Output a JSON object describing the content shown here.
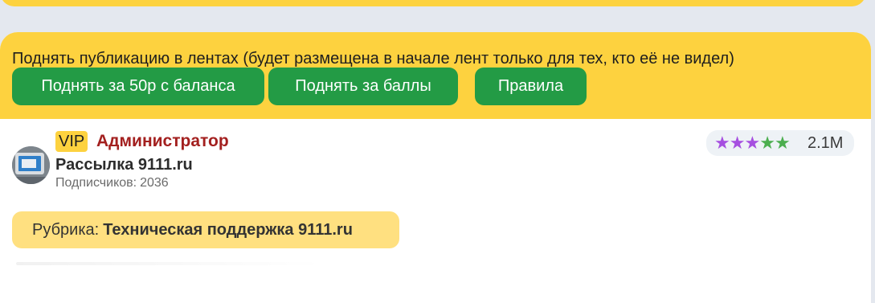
{
  "promo": {
    "text": "Поднять публикацию в лентах (будет размещена в начале лент только для тех, кто её не видел)",
    "buttons": {
      "raise_balance": "Поднять за 50р с баланса",
      "raise_points": "Поднять за баллы",
      "rules": "Правила"
    }
  },
  "author": {
    "badge": "VIP",
    "role": "Администратор",
    "channel_name": "Рассылка 9111.ru",
    "subscribers_label": "Подписчиков:",
    "subscribers_count": "2036"
  },
  "rating": {
    "stars": [
      {
        "symbol": "★",
        "color": "#a64fe0"
      },
      {
        "symbol": "★",
        "color": "#a64fe0"
      },
      {
        "symbol": "★",
        "color": "#a64fe0"
      },
      {
        "symbol": "★",
        "color": "#4cae4f"
      },
      {
        "symbol": "★",
        "color": "#4cae4f"
      }
    ],
    "value": "2.1M"
  },
  "rubric": {
    "label": "Рубрика:",
    "value": "Техническая поддержка 9111.ru"
  },
  "colors": {
    "accent_yellow": "#fdd23f",
    "button_green": "#239b45",
    "role_red": "#a3201f"
  }
}
